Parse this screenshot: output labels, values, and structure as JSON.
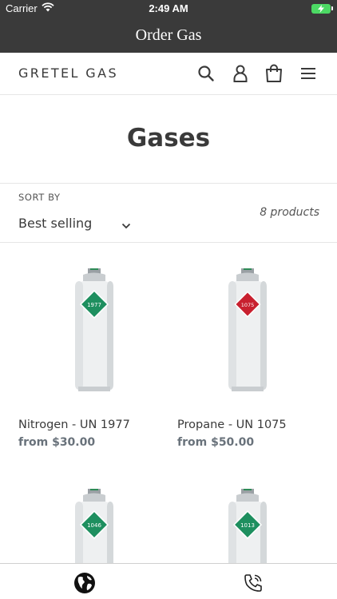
{
  "status": {
    "carrier": "Carrier",
    "time": "2:49 AM"
  },
  "nav": {
    "title": "Order Gas"
  },
  "header": {
    "brand": "GRETEL GAS",
    "icons": [
      "search-icon",
      "account-icon",
      "cart-icon",
      "menu-icon"
    ]
  },
  "page": {
    "title": "Gases"
  },
  "sort": {
    "label": "SORT BY",
    "value": "Best selling",
    "count": "8 products"
  },
  "products": [
    {
      "name": "Nitrogen - UN 1977",
      "price": "from $30.00",
      "label_code": "1977",
      "label_color": "#1e8f5f"
    },
    {
      "name": "Propane - UN 1075",
      "price": "from $50.00",
      "label_code": "1075",
      "label_color": "#c8202f"
    },
    {
      "name": "",
      "price": "",
      "label_code": "1046",
      "label_color": "#1e8f5f"
    },
    {
      "name": "",
      "price": "",
      "label_code": "1013",
      "label_color": "#1e8f5f"
    }
  ],
  "tabs": [
    {
      "icon": "globe-icon"
    },
    {
      "icon": "phone-icon"
    }
  ],
  "colors": {
    "bar": "#3a3a3a",
    "battery": "#4cd964",
    "price": "#69727b"
  }
}
